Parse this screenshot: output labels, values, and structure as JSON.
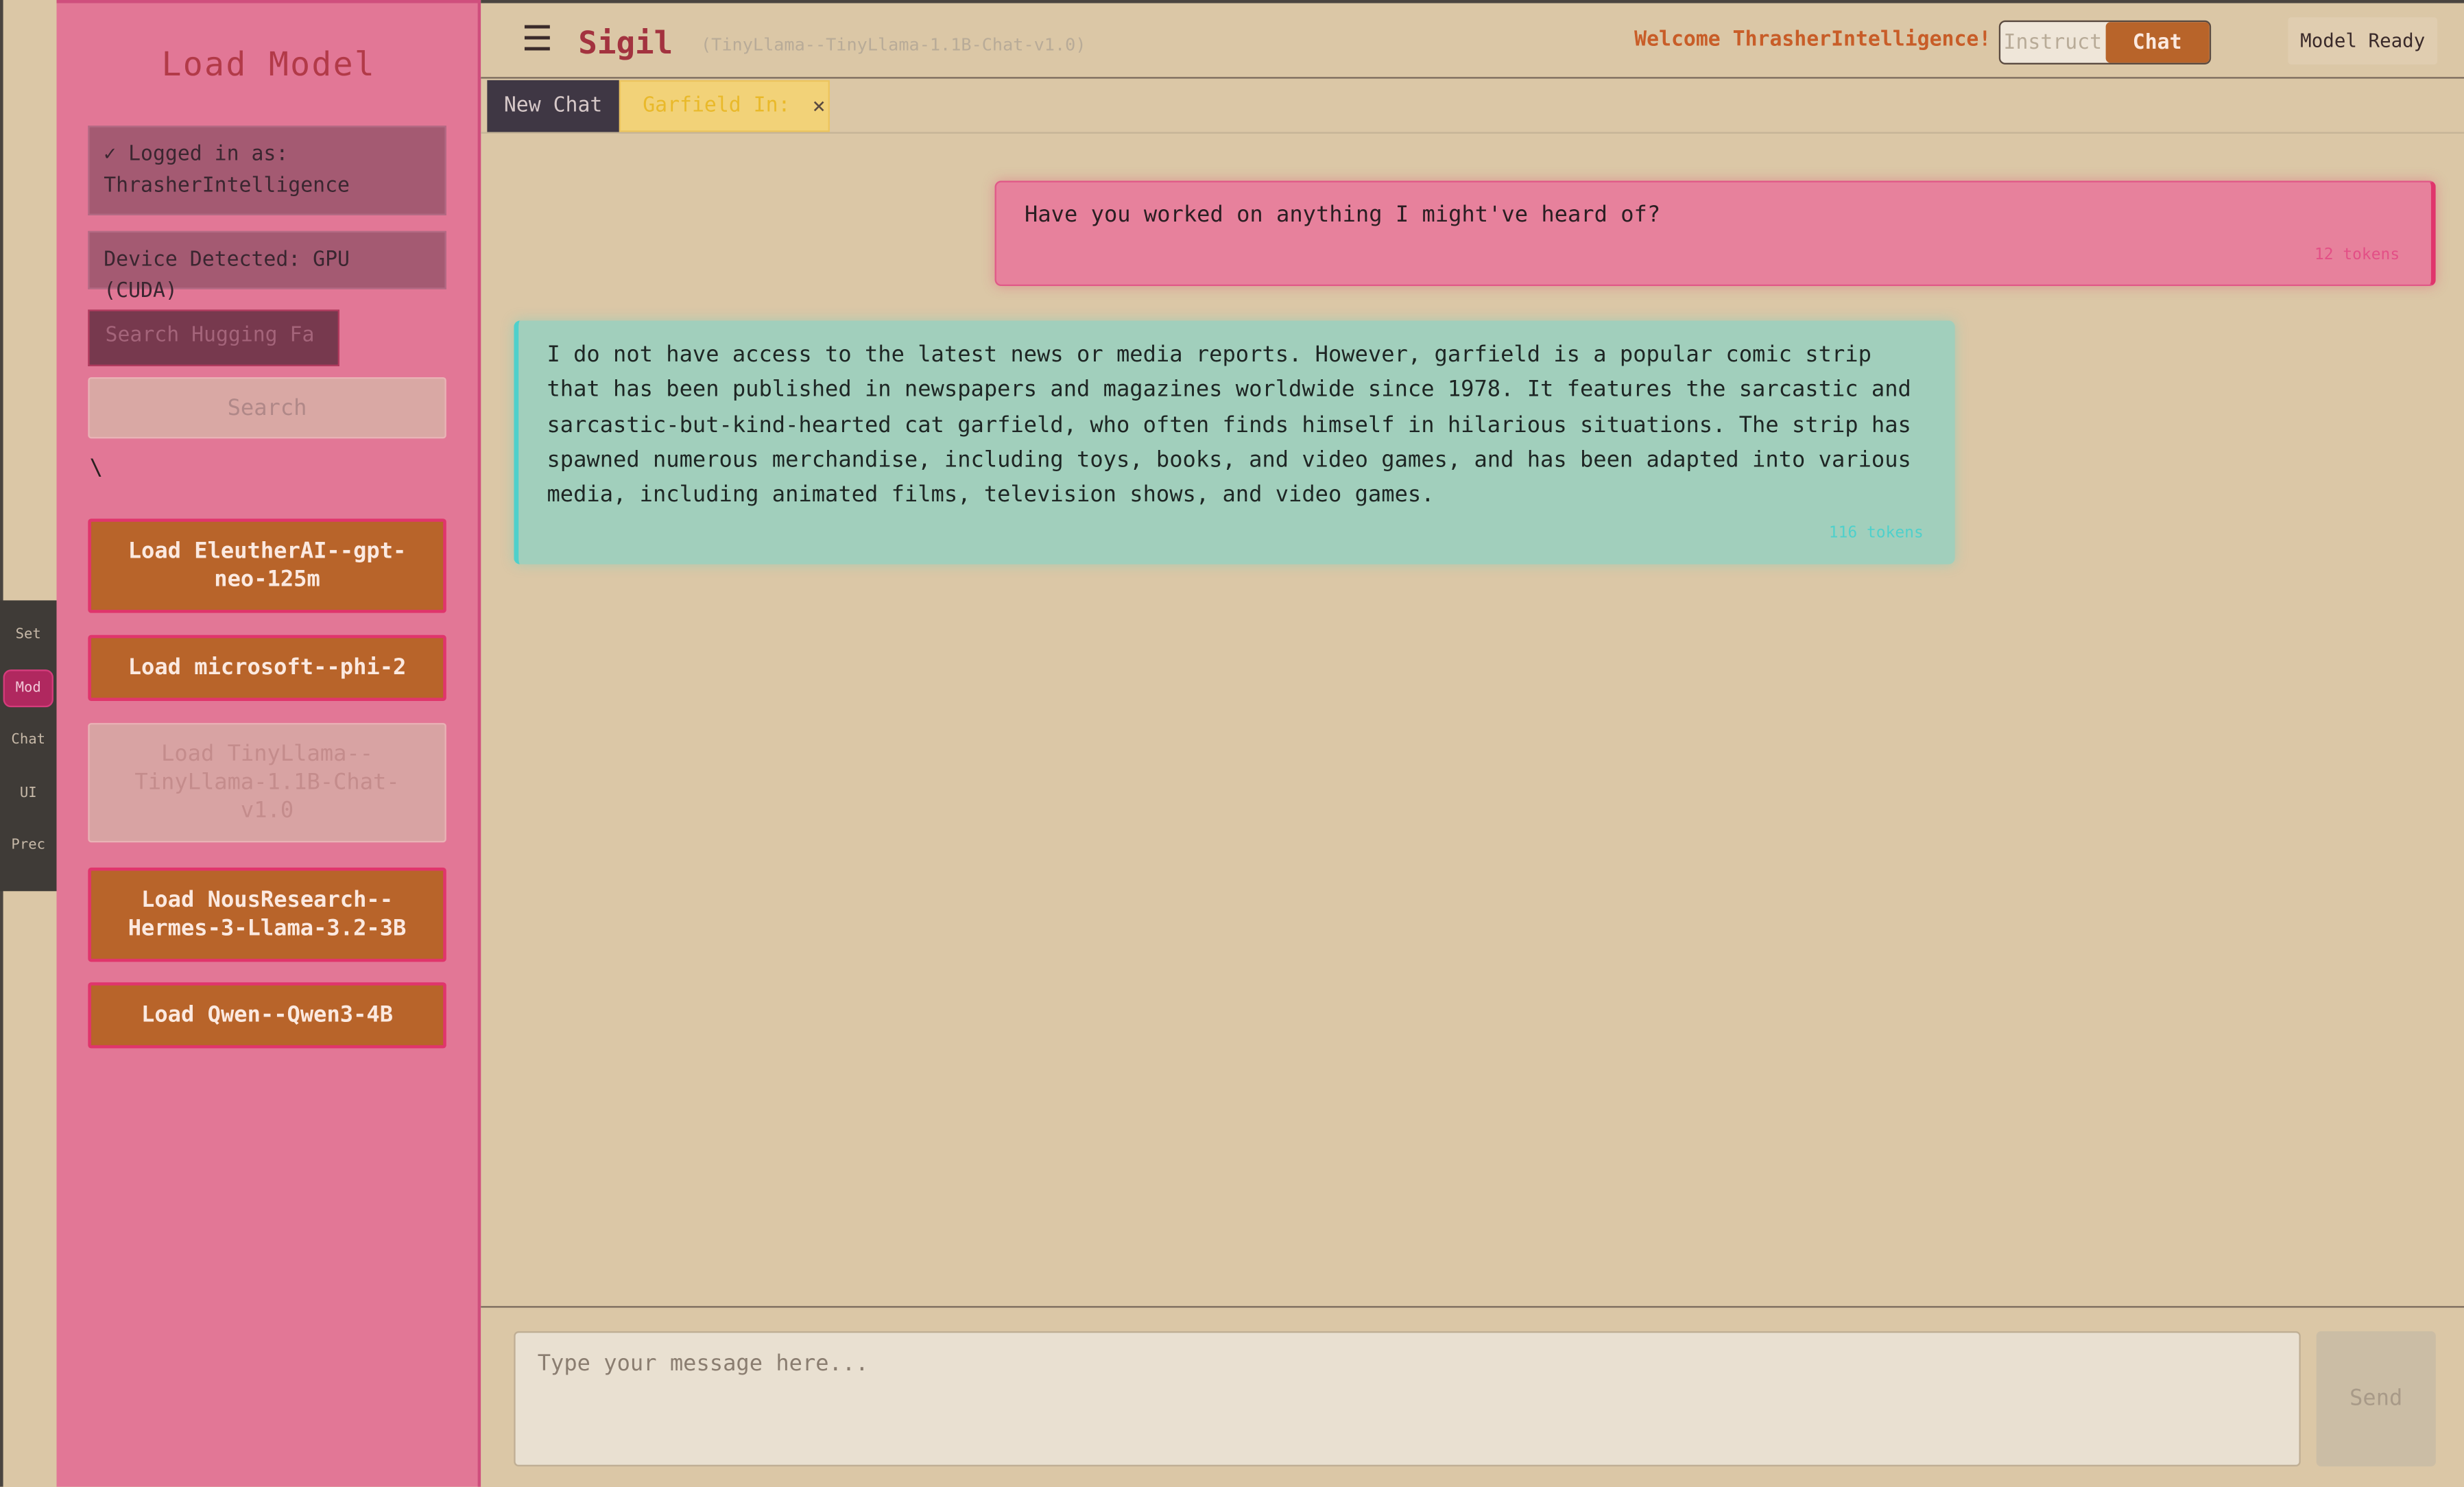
{
  "rail": {
    "tabs": [
      {
        "label": "Set",
        "active": false
      },
      {
        "label": "Mod",
        "active": true
      },
      {
        "label": "Chat",
        "active": false
      },
      {
        "label": "UI",
        "active": false
      },
      {
        "label": "Prec",
        "active": false
      }
    ]
  },
  "sidebar": {
    "title": "Load Model",
    "logged_in": "✓ Logged in as: ThrasherIntelligence",
    "device": "Device Detected: GPU (CUDA)",
    "search_placeholder": "Search Hugging Fa",
    "search_button": "Search",
    "stray_text": "\\",
    "load_buttons": [
      {
        "label": "Load EleutherAI--gpt-neo-125m",
        "disabled": false
      },
      {
        "label": "Load microsoft--phi-2",
        "disabled": false
      },
      {
        "label": "Load TinyLlama--TinyLlama-1.1B-Chat-v1.0",
        "disabled": true
      },
      {
        "label": "Load NousResearch--Hermes-3-Llama-3.2-3B",
        "disabled": false
      },
      {
        "label": "Load Qwen--Qwen3-4B",
        "disabled": false
      }
    ]
  },
  "header": {
    "menu_icon": "☰",
    "brand": "Sigil",
    "model": "(TinyLlama--TinyLlama-1.1B-Chat-v1.0)",
    "welcome": "Welcome ThrasherIntelligence!",
    "mode_options": [
      "Instruct",
      "Chat"
    ],
    "active_mode": "Chat",
    "status": "Model Ready"
  },
  "tabs": {
    "items": [
      {
        "label": "New Chat",
        "active": false
      },
      {
        "label": "Garfield In:",
        "active": true,
        "close": "×"
      }
    ]
  },
  "messages": [
    {
      "role": "user",
      "text": "Have you worked on anything I might've heard of?",
      "tokens": "12 tokens"
    },
    {
      "role": "assistant",
      "text": "I do not have access to the latest news or media reports. However, garfield is a popular comic strip that has been published in newspapers and magazines worldwide since 1978. It features the sarcastic and sarcastic-but-kind-hearted cat garfield, who often finds himself in hilarious situations. The strip has spawned numerous merchandise, including toys, books, and video games, and has been adapted into various media, including animated films, television shows, and video games.",
      "tokens": "116 tokens"
    }
  ],
  "composer": {
    "placeholder": "Type your message here...",
    "send_label": "Send"
  },
  "colors": {
    "background": "#dbc7a6",
    "sidebar": "#e27796",
    "accent_orange": "#b8642a",
    "accent_pink": "#e0356c",
    "assistant_bubble": "#a1cfbc",
    "user_bubble": "#e7819c"
  }
}
